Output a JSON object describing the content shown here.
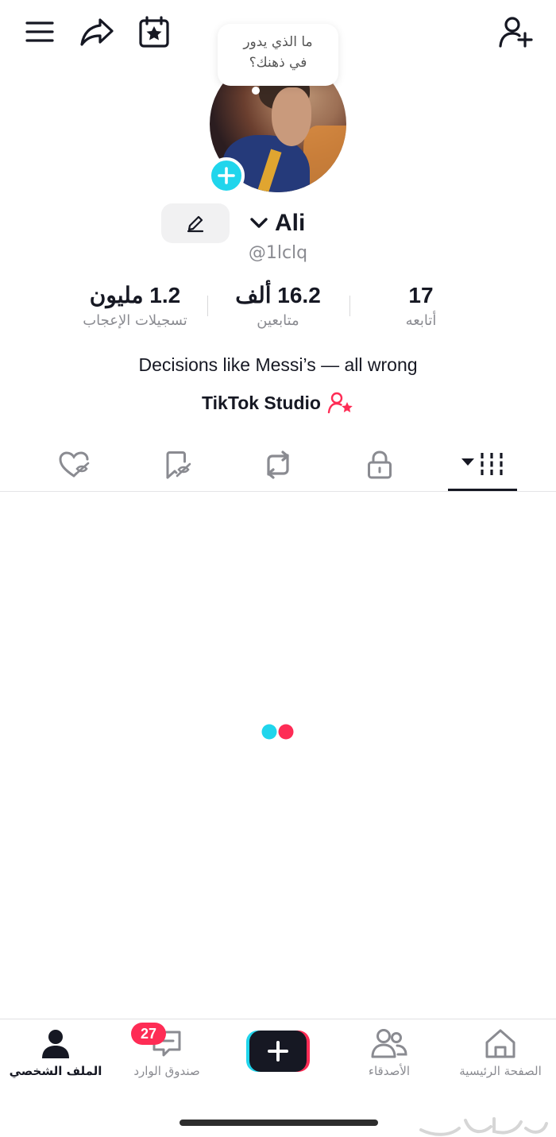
{
  "thought_bubble": {
    "line1": "ما الذي يدور",
    "line2": "في ذهنك؟"
  },
  "profile": {
    "name": "Ali",
    "handle": "@1lclq",
    "bio": "Decisions like Messi’s — all wrong",
    "studio_link": "TikTok Studio"
  },
  "stats": [
    {
      "value": "1.2 مليون",
      "label": "تسجيلات الإعجاب"
    },
    {
      "value": "16.2 ألف",
      "label": "متابعين"
    },
    {
      "value": "17",
      "label": "أتابعه"
    }
  ],
  "tabs": [
    {
      "icon": "liked-hidden-icon"
    },
    {
      "icon": "favorites-hidden-icon"
    },
    {
      "icon": "reposts-icon"
    },
    {
      "icon": "private-lock-icon"
    },
    {
      "icon": "videos-grid-icon",
      "active": true
    }
  ],
  "bottom_nav": {
    "profile": "الملف الشخصي",
    "inbox": "صندوق الوارد",
    "inbox_badge": "27",
    "friends": "الأصدقاء",
    "home": "الصفحة الرئيسية"
  },
  "colors": {
    "accent_cyan": "#20d5ec",
    "accent_red": "#fe2c55",
    "text": "#161823",
    "muted": "#8a8b91"
  }
}
